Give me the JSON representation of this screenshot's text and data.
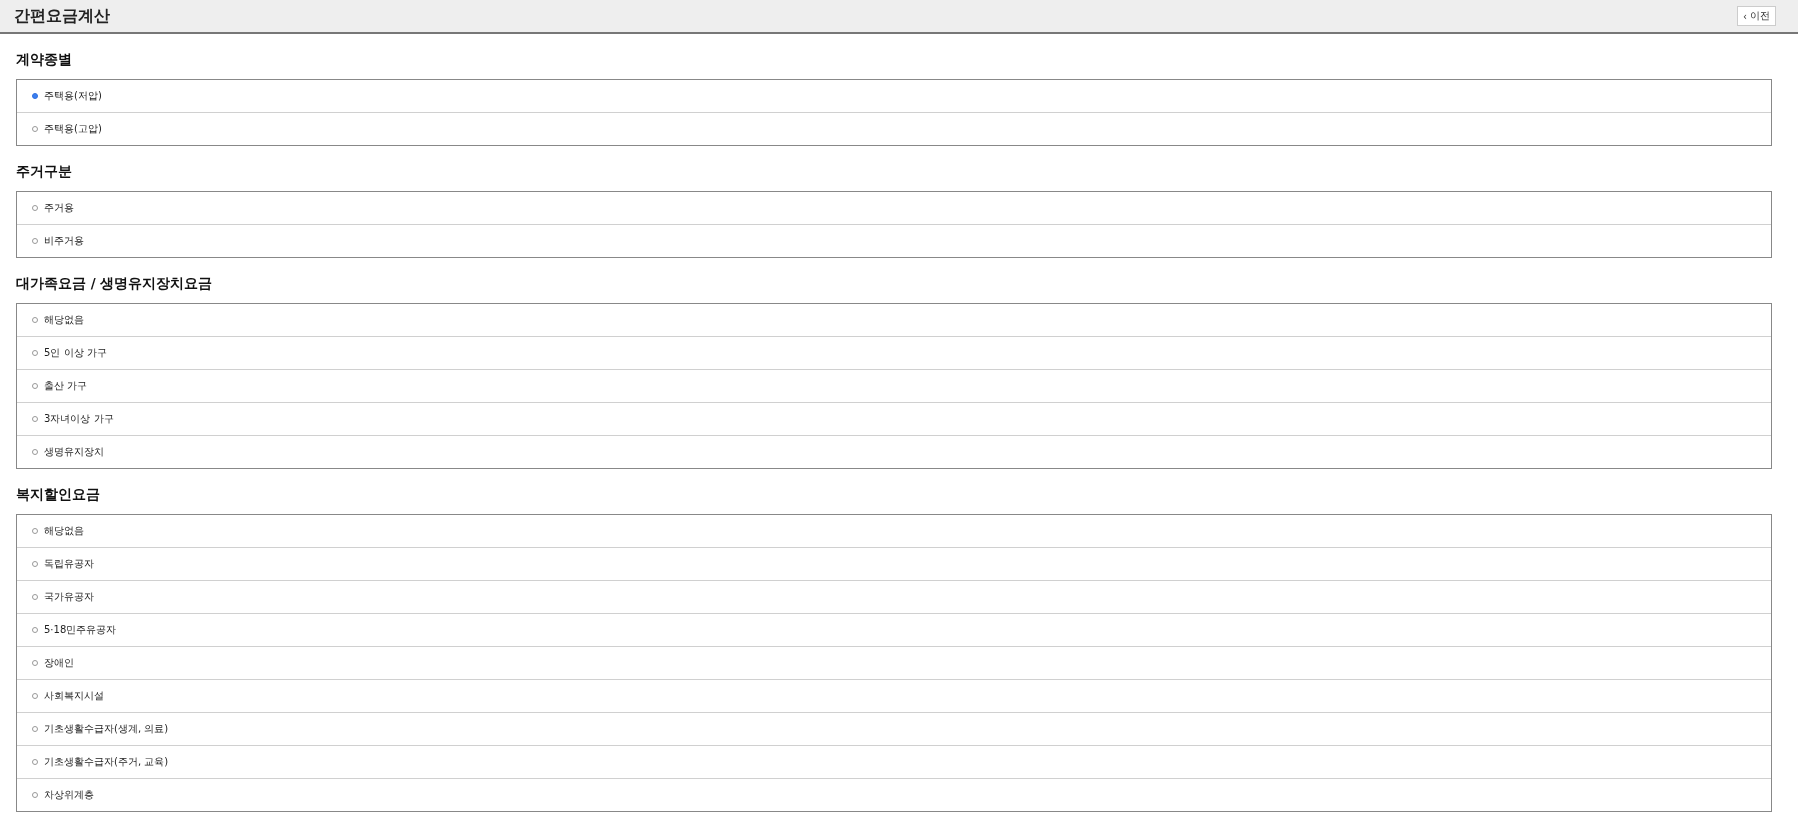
{
  "header": {
    "title": "간편요금계산",
    "back_button": {
      "icon": "‹",
      "label": "이전"
    }
  },
  "sections": [
    {
      "title": "계약종별",
      "options": [
        {
          "label": "주택용(저압)",
          "selected": true
        },
        {
          "label": "주택용(고압)",
          "selected": false
        }
      ]
    },
    {
      "title": "주거구분",
      "options": [
        {
          "label": "주거용",
          "selected": false
        },
        {
          "label": "비주거용",
          "selected": false
        }
      ]
    },
    {
      "title": "대가족요금 / 생명유지장치요금",
      "options": [
        {
          "label": "해당없음",
          "selected": false
        },
        {
          "label": "5인 이상 가구",
          "selected": false
        },
        {
          "label": "출산 가구",
          "selected": false
        },
        {
          "label": "3자녀이상 가구",
          "selected": false
        },
        {
          "label": "생명유지장치",
          "selected": false
        }
      ]
    },
    {
      "title": "복지할인요금",
      "options": [
        {
          "label": "해당없음",
          "selected": false
        },
        {
          "label": "독립유공자",
          "selected": false
        },
        {
          "label": "국가유공자",
          "selected": false
        },
        {
          "label": "5·18민주유공자",
          "selected": false
        },
        {
          "label": "장애인",
          "selected": false
        },
        {
          "label": "사회복지시설",
          "selected": false
        },
        {
          "label": "기초생활수급자(생계, 의료)",
          "selected": false
        },
        {
          "label": "기초생활수급자(주거, 교육)",
          "selected": false
        },
        {
          "label": "차상위계층",
          "selected": false
        }
      ]
    }
  ]
}
